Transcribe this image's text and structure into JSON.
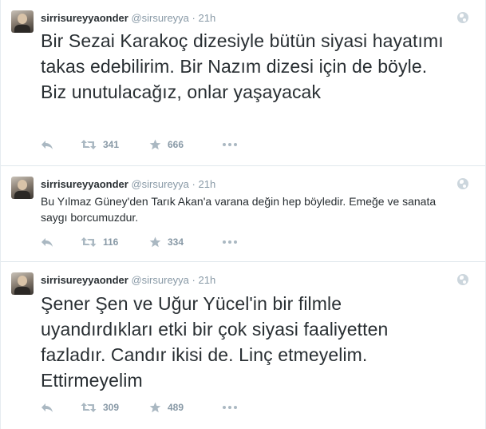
{
  "tweets": [
    {
      "name": "sirrisureyyaonder",
      "handle": "@sirsureyya",
      "separator": "·",
      "time": "21h",
      "text": "Bir Sezai Karakoç dizesiyle bütün siyasi hayatımı takas edebilirim. Bir Nazım dizesi için de böyle. Biz unutulacağız, onlar yaşayacak",
      "retweets": "341",
      "favorites": "666"
    },
    {
      "name": "sirrisureyyaonder",
      "handle": "@sirsureyya",
      "separator": "·",
      "time": "21h",
      "text": "Bu Yılmaz Güney'den Tarık Akan'a varana değin hep böyledir. Emeğe ve sanata saygı borcumuzdur.",
      "retweets": "116",
      "favorites": "334"
    },
    {
      "name": "sirrisureyyaonder",
      "handle": "@sirsureyya",
      "separator": "·",
      "time": "21h",
      "text": "Şener Şen ve Uğur Yücel'in bir filmle uyandırdıkları etki bir çok siyasi faaliyetten fazladır. Candır ikisi de. Linç etmeyelim. Ettirmeyelim",
      "retweets": "309",
      "favorites": "489"
    }
  ],
  "icons": {
    "reply": "reply-icon",
    "retweet": "retweet-icon",
    "favorite": "star-icon",
    "more": "more-icon",
    "globe": "globe-icon"
  },
  "colors": {
    "text": "#292f33",
    "muted": "#8899a6",
    "icon": "#aab8c2",
    "divider": "#e1e8ed"
  }
}
